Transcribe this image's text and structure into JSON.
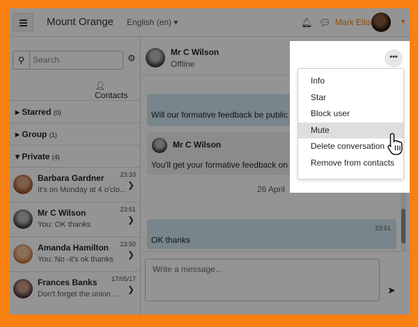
{
  "navbar": {
    "site_name": "Mount Orange",
    "language": "English (en)",
    "user_name": "Mark Ellis"
  },
  "sidebar": {
    "search_placeholder": "Search",
    "contacts_label": "Contacts",
    "sections": [
      {
        "label": "Starred",
        "count": "(0)",
        "expanded": false
      },
      {
        "label": "Group",
        "count": "(1)",
        "expanded": false
      },
      {
        "label": "Private",
        "count": "(4)",
        "expanded": true
      }
    ],
    "conversations": [
      {
        "name": "Barbara Gardner",
        "time": "23:33",
        "preview": "It's on Monday at 4 o'clo..."
      },
      {
        "name": "Mr C Wilson",
        "time": "23:51",
        "preview": "You: OK thanks"
      },
      {
        "name": "Amanda Hamilton",
        "time": "23:50",
        "preview": "You: No -it's ok thanks"
      },
      {
        "name": "Frances Banks",
        "time": "17/05/17",
        "preview": "Don't forget the union ..."
      }
    ]
  },
  "conversation": {
    "name": "Mr C Wilson",
    "status": "Offline",
    "messages": [
      {
        "text": "Will our formative feedback be public on Friday?"
      },
      {
        "sender": "Mr C Wilson",
        "text": "You'll get your formative feedback on Friday."
      },
      {
        "text": "OK thanks",
        "time": "23:51"
      }
    ],
    "date_separator": "26 April",
    "composer_placeholder": "Write a message..."
  },
  "menu": {
    "items": [
      "Info",
      "Star",
      "Block user",
      "Mute",
      "Delete conversation",
      "Remove from contacts"
    ],
    "highlighted": "Mute"
  },
  "colors": {
    "brand": "#f98012",
    "overlay": "rgba(0,0,0,0.42)"
  }
}
